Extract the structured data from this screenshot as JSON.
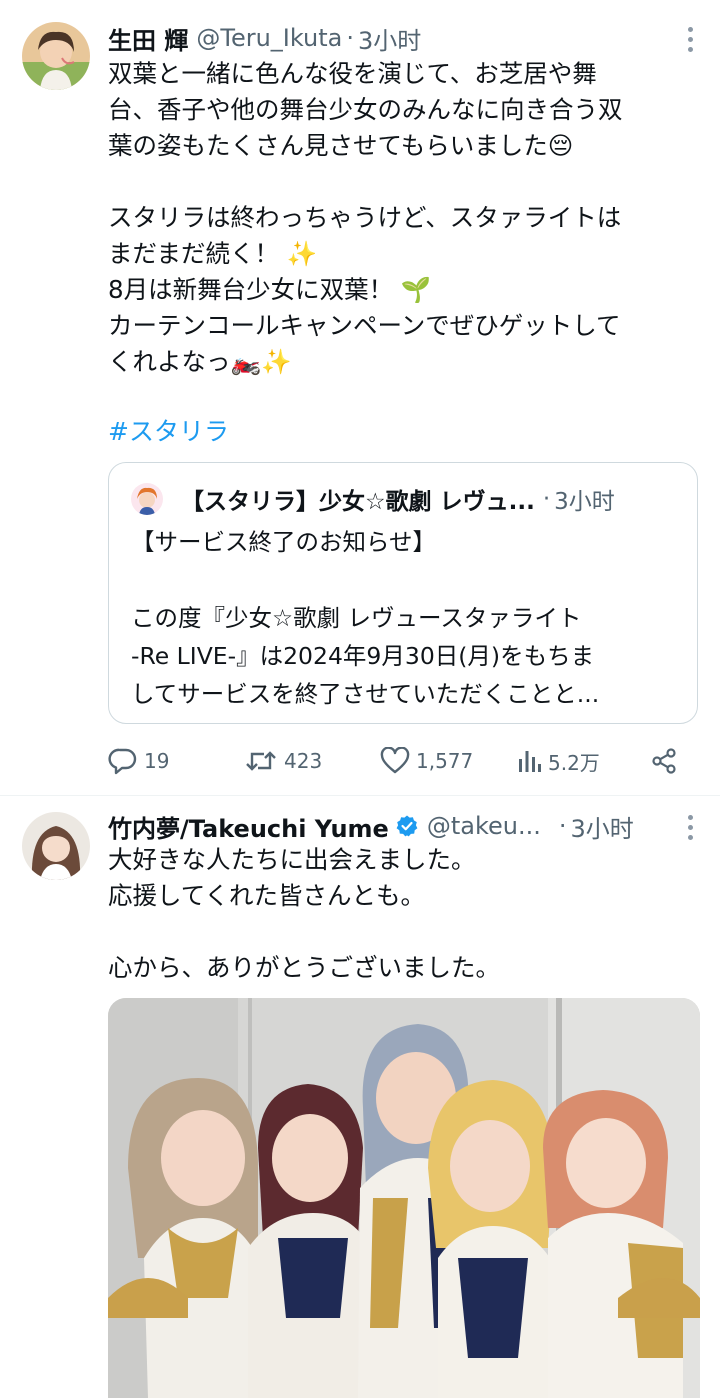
{
  "tweet1": {
    "display_name": "生田 輝",
    "handle": "@Teru_Ikuta",
    "separator": "·",
    "time": "3小时",
    "lines": [
      "双葉と一緒に色んな役を演じて、お芝居や舞",
      "台、香子や他の舞台少女のみんなに向き合う双",
      "葉の姿もたくさん見させてもらいました😔",
      "",
      "スタリラは終わっちゃうけど、スタァライトは",
      "まだまだ続く！ ✨",
      "8月は新舞台少女に双葉！ 🌱",
      "カーテンコールキャンペーンでぜひゲットして",
      "くれよなっ🏍️✨"
    ],
    "hashtag": "#スタリラ",
    "quote": {
      "display_name": "【スタリラ】少女☆歌劇 レヴュ...",
      "separator": "·",
      "time": "3小时",
      "lines": [
        "【サービス終了のお知らせ】",
        "",
        "この度『少女☆歌劇 レヴュースタァライト",
        "-Re LIVE-』は2024年9月30日(月)をもちま",
        "してサービスを終了させていただくことと..."
      ]
    },
    "actions": {
      "replies": "19",
      "retweets": "423",
      "likes": "1,577",
      "views": "5.2万"
    }
  },
  "tweet2": {
    "display_name": "竹内夢/Takeuchi Yume",
    "handle": "@takeu...",
    "separator": "·",
    "time": "3小时",
    "lines": [
      "大好きな人たちに出会えました。",
      "応援してくれた皆さんとも。",
      "",
      "心から、ありがとうございました。"
    ]
  },
  "icons": {
    "reply": "reply-icon",
    "retweet": "retweet-icon",
    "like": "heart-icon",
    "views": "views-chart-icon",
    "share": "share-icon",
    "more": "more-options-icon",
    "verified": "verified-badge-icon"
  },
  "colors": {
    "link": "#1d9bf0",
    "secondary_text": "#536471",
    "border": "#cfd9de"
  }
}
